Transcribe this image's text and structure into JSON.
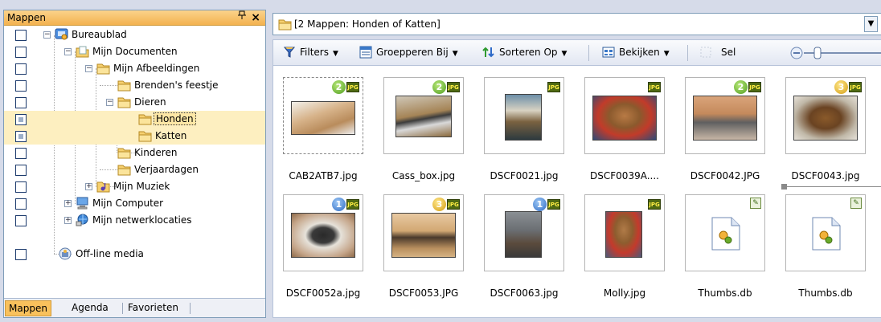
{
  "folders_pane": {
    "title": "Mappen",
    "pin_icon": "pin-icon",
    "close_label": "×",
    "tree": [
      {
        "label": "Bureaublad"
      },
      {
        "label": "Mijn Documenten"
      },
      {
        "label": "Mijn Afbeeldingen"
      },
      {
        "label": "Brenden's feestje"
      },
      {
        "label": "Dieren"
      },
      {
        "label": "Honden"
      },
      {
        "label": "Katten"
      },
      {
        "label": "Kinderen"
      },
      {
        "label": "Verjaardagen"
      },
      {
        "label": "Mijn Muziek"
      },
      {
        "label": "Mijn Computer"
      },
      {
        "label": "Mijn netwerklocaties"
      },
      {
        "label": "Off-line media"
      }
    ],
    "tabs": [
      "Mappen",
      "Agenda",
      "Favorieten"
    ]
  },
  "address_bar": {
    "text": "[2 Mappen: Honden of Katten]",
    "icon": "folder-icon"
  },
  "toolbar": {
    "filters": "Filters",
    "group_by": "Groepperen Bij",
    "sort_by": "Sorteren Op",
    "view": "Bekijken",
    "select": "Sel"
  },
  "badge_text": "JPG",
  "files": [
    {
      "name": "CAB2ATB7.jpg",
      "badge": "2",
      "badge_color": "green"
    },
    {
      "name": "Cass_box.jpg",
      "badge": "2",
      "badge_color": "green"
    },
    {
      "name": "DSCF0021.jpg",
      "badge": "",
      "badge_color": ""
    },
    {
      "name": "DSCF0039A....",
      "badge": "",
      "badge_color": ""
    },
    {
      "name": "DSCF0042.JPG",
      "badge": "2",
      "badge_color": "green"
    },
    {
      "name": "DSCF0043.jpg",
      "badge": "3",
      "badge_color": "gold"
    },
    {
      "name": "DSCF0052a.jpg",
      "badge": "1",
      "badge_color": "blue"
    },
    {
      "name": "DSCF0053.JPG",
      "badge": "3",
      "badge_color": "gold"
    },
    {
      "name": "DSCF0063.jpg",
      "badge": "1",
      "badge_color": "blue"
    },
    {
      "name": "Molly.jpg",
      "badge": "",
      "badge_color": ""
    },
    {
      "name": "Thumbs.db",
      "badge": "",
      "badge_color": ""
    },
    {
      "name": "Thumbs.db",
      "badge": "",
      "badge_color": ""
    }
  ],
  "colors": {
    "accent": "#f3b24f",
    "selection": "#fdefc0",
    "border": "#7f9db9"
  }
}
